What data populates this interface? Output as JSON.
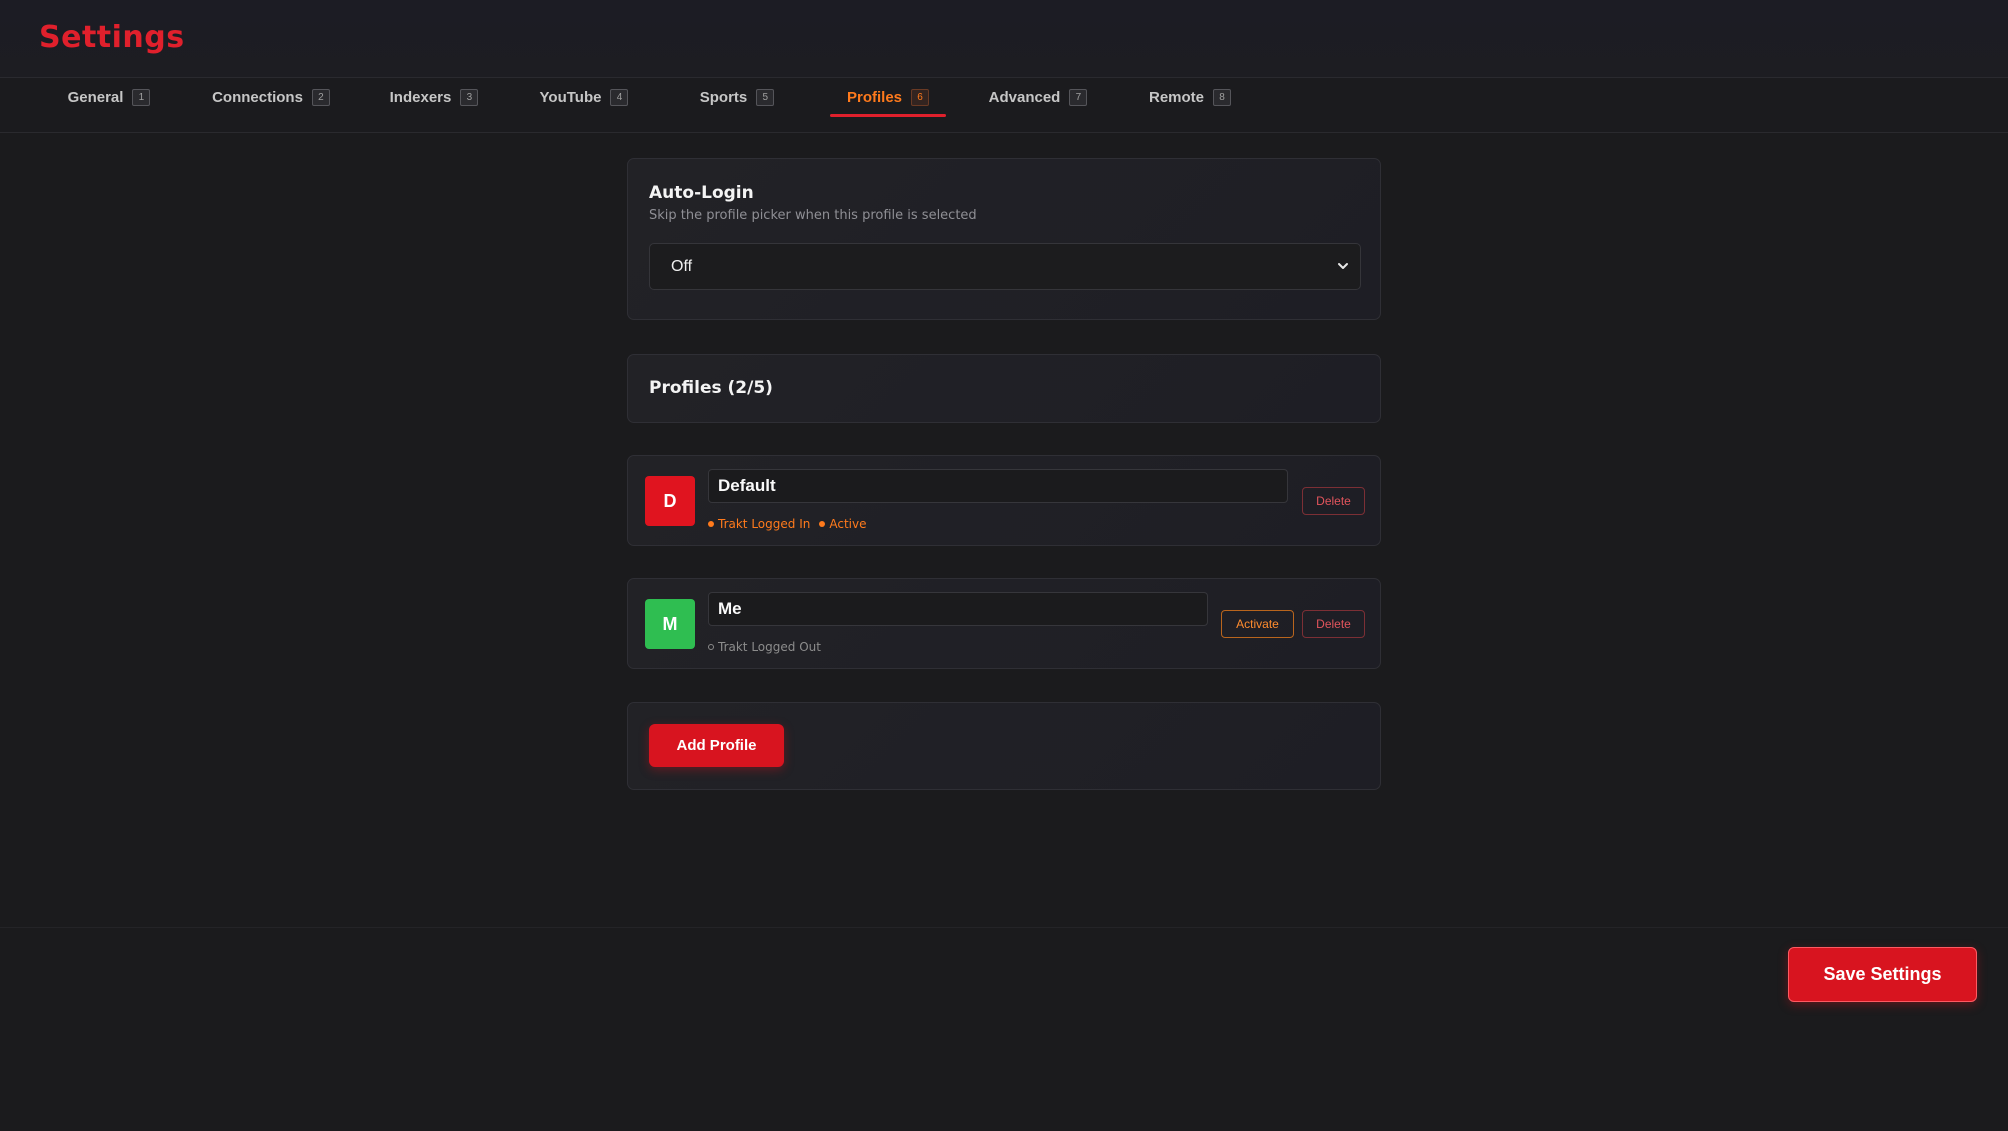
{
  "header": {
    "title": "Settings"
  },
  "tabs": [
    {
      "label": "General",
      "key": "1"
    },
    {
      "label": "Connections",
      "key": "2"
    },
    {
      "label": "Indexers",
      "key": "3"
    },
    {
      "label": "YouTube",
      "key": "4"
    },
    {
      "label": "Sports",
      "key": "5"
    },
    {
      "label": "Profiles",
      "key": "6",
      "active": true
    },
    {
      "label": "Advanced",
      "key": "7"
    },
    {
      "label": "Remote",
      "key": "8"
    }
  ],
  "auto_login": {
    "title": "Auto-Login",
    "description": "Skip the profile picker when this profile is selected",
    "selected": "Off"
  },
  "profiles": {
    "header": "Profiles (2/5)",
    "items": [
      {
        "initial": "D",
        "name": "Default",
        "color": "#e0141f",
        "statuses": [
          {
            "text": "Trakt Logged In",
            "on": true
          },
          {
            "text": "Active",
            "on": true
          }
        ],
        "delete_label": "Delete"
      },
      {
        "initial": "M",
        "name": "Me",
        "color": "#2fbe51",
        "statuses": [
          {
            "text": "Trakt Logged Out",
            "on": false
          }
        ],
        "activate_label": "Activate",
        "delete_label": "Delete"
      }
    ],
    "add_label": "Add Profile"
  },
  "footer": {
    "save_label": "Save Settings"
  },
  "colors": {
    "accent": "#e0202c",
    "active_tab": "#ff7a1c",
    "background": "#1b1b1d"
  },
  "icons": {
    "select_chevron": "chevron-down-icon"
  }
}
